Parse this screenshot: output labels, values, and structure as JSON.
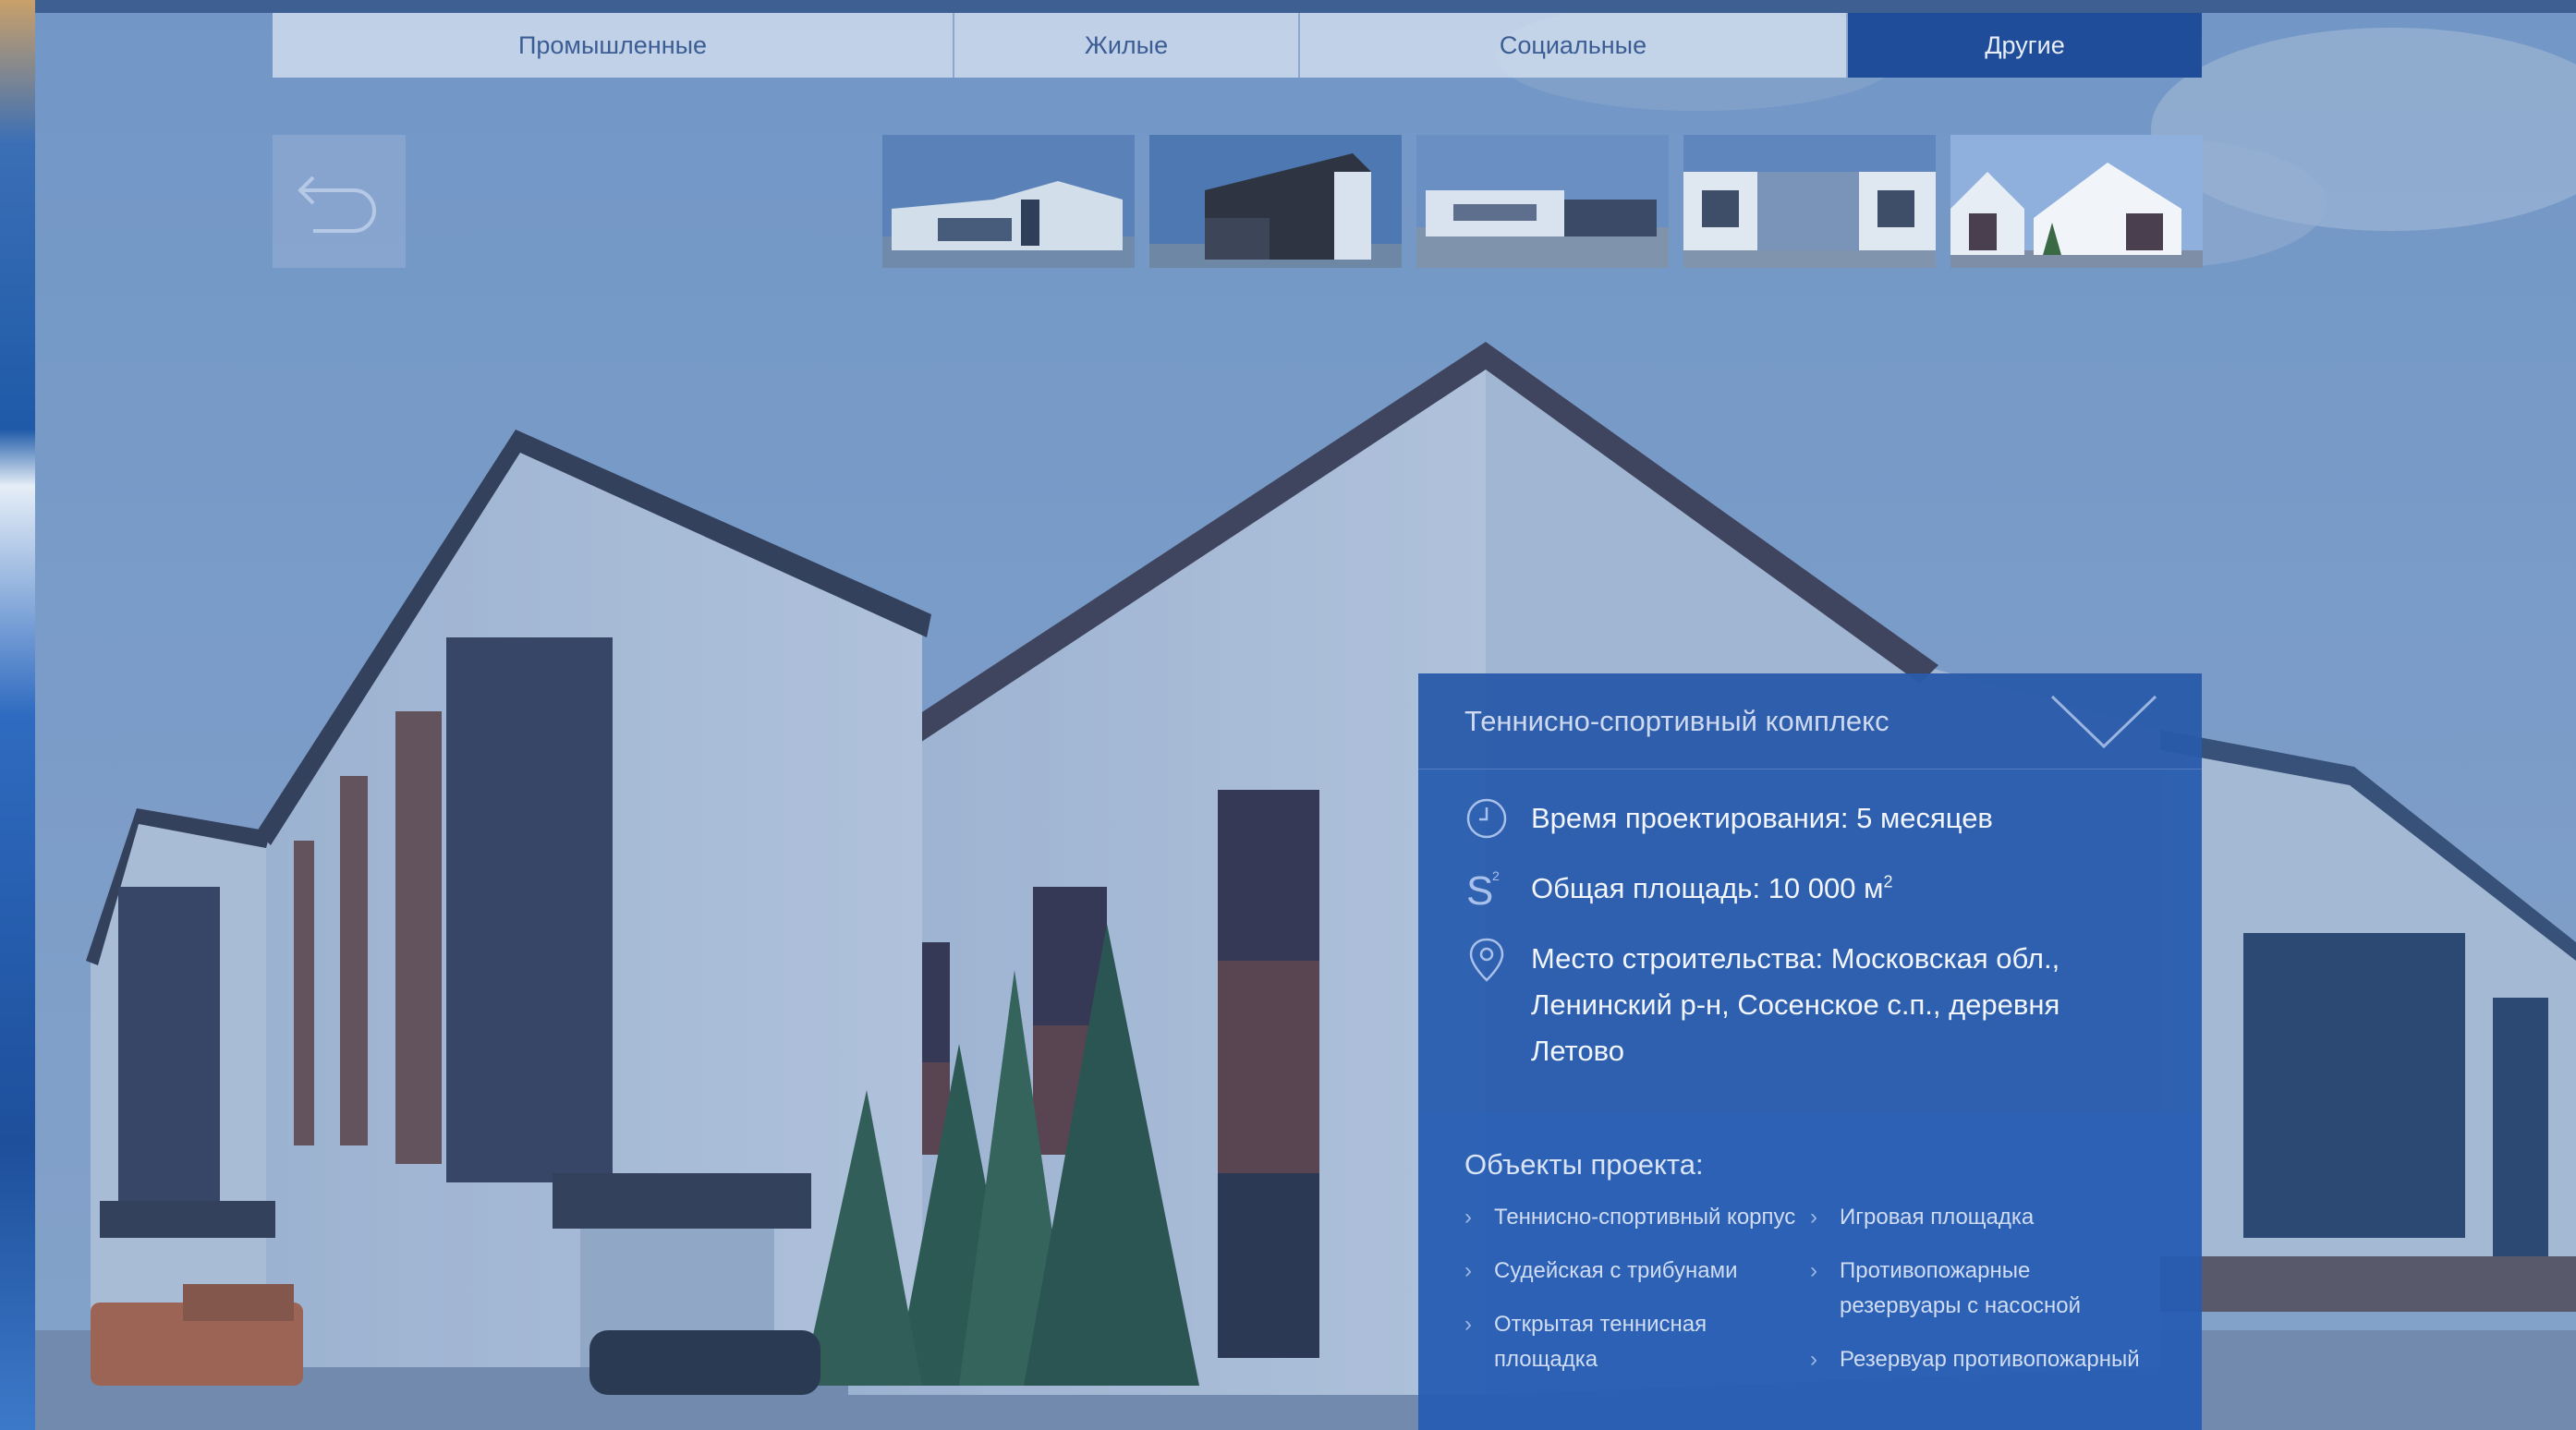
{
  "tabs": [
    {
      "label": "Промышленные",
      "active": false
    },
    {
      "label": "Жилые",
      "active": false
    },
    {
      "label": "Социальные",
      "active": false
    },
    {
      "label": "Другие",
      "active": true
    }
  ],
  "back_button": {
    "icon": "back-arrow-icon"
  },
  "thumbnails": [
    {
      "icon": "building-photo"
    },
    {
      "icon": "building-photo"
    },
    {
      "icon": "building-photo"
    },
    {
      "icon": "building-photo"
    },
    {
      "icon": "building-photo"
    }
  ],
  "panel": {
    "title": "Теннисно-спортивный комплекс",
    "facts": [
      {
        "icon": "clock-icon",
        "text": "Время проектирования: 5 месяцев"
      },
      {
        "icon": "area-icon",
        "text_pre": "Общая площадь: 10 000 м",
        "sup": "2"
      },
      {
        "icon": "location-pin-icon",
        "text": "Место строительства: Московская обл., Ленинский р-н, Сосенское с.п., деревня Летово"
      }
    ],
    "objects_title": "Объекты проекта:",
    "objects_left": [
      "Теннисно-спортивный корпус",
      "Судейская с трибунами",
      "Открытая теннисная площадка"
    ],
    "objects_right": [
      "Игровая площадка",
      "Противопожарные резервуары с насосной",
      "Резервуар противопожарный"
    ]
  },
  "colors": {
    "accent": "#1f4d9a",
    "panel": "#1e54aa"
  }
}
